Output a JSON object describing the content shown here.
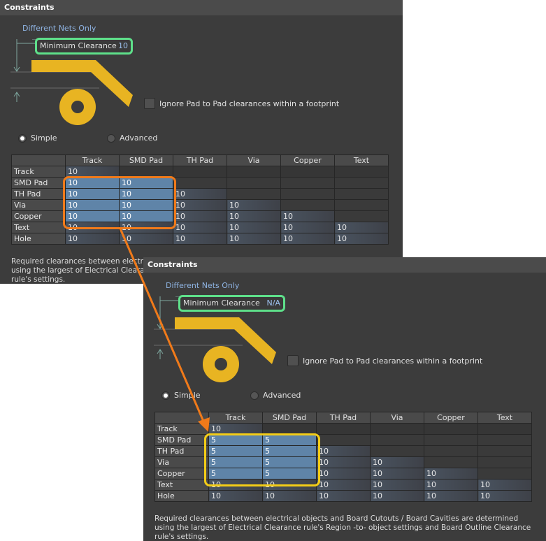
{
  "panels": [
    {
      "title": "Constraints",
      "net_scope": "Different Nets Only",
      "min_clearance_label": "Minimum Clearance",
      "min_clearance_value": "10",
      "ignore_pad_label": "Ignore Pad to Pad clearances within a footprint",
      "ignore_pad_checked": false,
      "mode_options": [
        "Simple",
        "Advanced"
      ],
      "mode_selected": "Simple",
      "columns": [
        "Track",
        "SMD Pad",
        "TH Pad",
        "Via",
        "Copper",
        "Text"
      ],
      "rows": [
        {
          "label": "Track",
          "values": [
            "10",
            "",
            "",
            "",
            "",
            ""
          ]
        },
        {
          "label": "SMD Pad",
          "values": [
            "10",
            "10",
            "",
            "",
            "",
            ""
          ]
        },
        {
          "label": "TH Pad",
          "values": [
            "10",
            "10",
            "10",
            "",
            "",
            ""
          ]
        },
        {
          "label": "Via",
          "values": [
            "10",
            "10",
            "10",
            "10",
            "",
            ""
          ]
        },
        {
          "label": "Copper",
          "values": [
            "10",
            "10",
            "10",
            "10",
            "10",
            ""
          ]
        },
        {
          "label": "Text",
          "values": [
            "10",
            "10",
            "10",
            "10",
            "10",
            "10"
          ]
        },
        {
          "label": "Hole",
          "values": [
            "10",
            "10",
            "10",
            "10",
            "10",
            "10"
          ]
        }
      ],
      "note": "Required clearances between electrical objects and Board Cutouts / Board Cavities are determined using the largest of Electrical Clearance rule's Region -to- object settings and Board Outline Clearance rule's settings."
    },
    {
      "title": "Constraints",
      "net_scope": "Different Nets Only",
      "min_clearance_label": "Minimum Clearance",
      "min_clearance_value": "N/A",
      "ignore_pad_label": "Ignore Pad to Pad clearances within a footprint",
      "ignore_pad_checked": false,
      "mode_options": [
        "Simple",
        "Advanced"
      ],
      "mode_selected": "Simple",
      "columns": [
        "Track",
        "SMD Pad",
        "TH Pad",
        "Via",
        "Copper",
        "Text"
      ],
      "rows": [
        {
          "label": "Track",
          "values": [
            "10",
            "",
            "",
            "",
            "",
            ""
          ]
        },
        {
          "label": "SMD Pad",
          "values": [
            "5",
            "5",
            "",
            "",
            "",
            ""
          ]
        },
        {
          "label": "TH Pad",
          "values": [
            "5",
            "5",
            "10",
            "",
            "",
            ""
          ]
        },
        {
          "label": "Via",
          "values": [
            "5",
            "5",
            "10",
            "10",
            "",
            ""
          ]
        },
        {
          "label": "Copper",
          "values": [
            "5",
            "5",
            "10",
            "10",
            "10",
            ""
          ]
        },
        {
          "label": "Text",
          "values": [
            "10",
            "10",
            "10",
            "10",
            "10",
            "10"
          ]
        },
        {
          "label": "Hole",
          "values": [
            "10",
            "10",
            "10",
            "10",
            "10",
            "10"
          ]
        }
      ],
      "note": "Required clearances between electrical objects and Board Cutouts / Board Cavities are determined using the largest of Electrical Clearance rule's Region -to- object settings and Board Outline Clearance rule's settings."
    }
  ],
  "annotations": {
    "highlight_before_color": "#f07a1a",
    "highlight_after_color": "#f3cc17",
    "min_clearance_highlight_color": "#5ee08a",
    "arrow_color": "#f07a1a"
  },
  "colors": {
    "panel_bg": "#3c3c3c",
    "title_bg": "#4b4b4b",
    "link_blue": "#8fb4e3",
    "selected_cell": "#5f84a8",
    "copper_yellow": "#e8b422"
  }
}
